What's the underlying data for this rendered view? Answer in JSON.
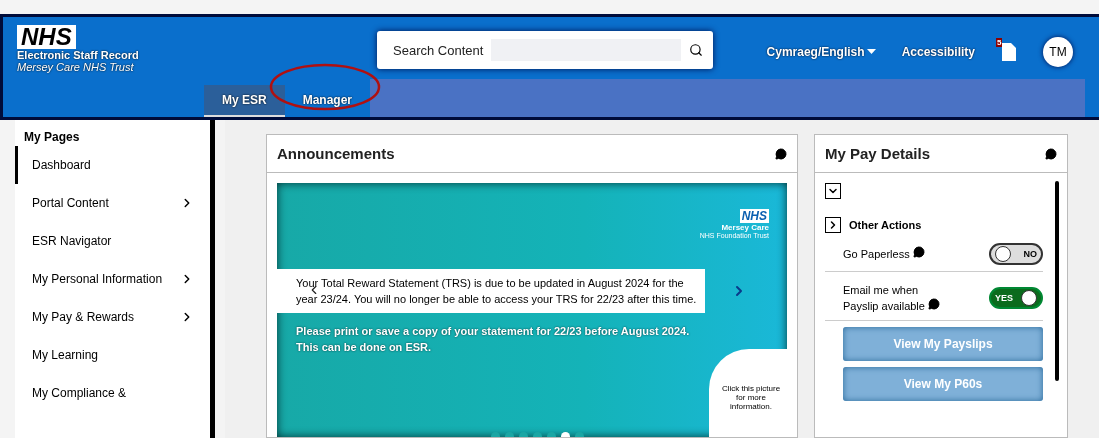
{
  "header": {
    "logo": {
      "mark": "NHS",
      "title": "Electronic Staff Record",
      "org": "Mersey Care NHS Trust"
    },
    "search": {
      "placeholder": "Search Content"
    },
    "language": "Cymraeg/English",
    "accessibility": "Accessibility",
    "notifications_badge": "5",
    "avatar": "TM"
  },
  "tabs": [
    {
      "label": "My ESR",
      "selected": true,
      "circled": false
    },
    {
      "label": "Manager",
      "selected": false,
      "circled": true
    }
  ],
  "sidebar": {
    "heading": "My Pages",
    "items": [
      {
        "label": "Dashboard",
        "selected": true,
        "has_children": false
      },
      {
        "label": "Portal Content",
        "selected": false,
        "has_children": true
      },
      {
        "label": "ESR Navigator",
        "selected": false,
        "has_children": false
      },
      {
        "label": "My Personal Information",
        "selected": false,
        "has_children": true
      },
      {
        "label": "My Pay & Rewards",
        "selected": false,
        "has_children": true
      },
      {
        "label": "My Learning",
        "selected": false,
        "has_children": false
      },
      {
        "label": "My Compliance &",
        "selected": false,
        "has_children": false
      }
    ]
  },
  "announcements": {
    "title": "Announcements",
    "slide": {
      "logo_mark": "NHS",
      "logo_org": "Mersey Care",
      "logo_sub": "NHS Foundation Trust",
      "notice": "Your Total Reward Statement (TRS) is due to be updated in August 2024 for the year 23/24. You will no longer be able to access your TRS for 22/23 after this time.",
      "body": "Please print or save a copy of your statement for 22/23 before August 2024. This can be done on ESR.",
      "callout": "Click this picture for more information."
    },
    "dots": [
      {
        "selected": false
      },
      {
        "selected": false
      },
      {
        "selected": false
      },
      {
        "selected": false
      },
      {
        "selected": false
      },
      {
        "selected": true
      },
      {
        "selected": false
      }
    ]
  },
  "pay_details": {
    "title": "My Pay Details",
    "other_actions": "Other Actions",
    "toggles": [
      {
        "label": "Go Paperless",
        "on": false,
        "state_text": "NO"
      },
      {
        "label": "Email me when Payslip available",
        "on": true,
        "state_text": "YES"
      }
    ],
    "buttons": [
      "View My Payslips",
      "View My P60s"
    ]
  }
}
